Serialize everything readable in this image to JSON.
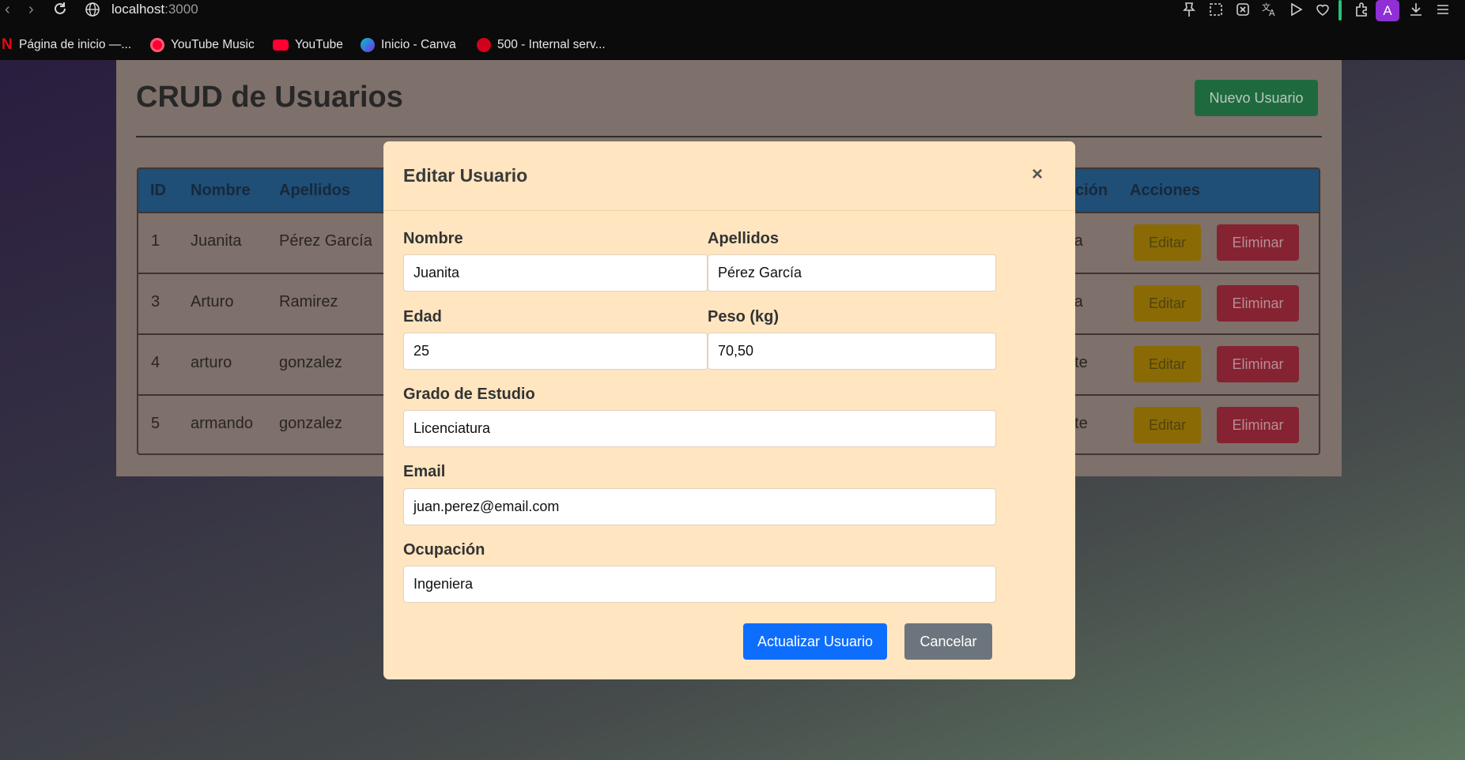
{
  "browser": {
    "url_host": "localhost",
    "url_port": ":3000",
    "avatar_letter": "A",
    "bookmarks": [
      {
        "label": "Página de inicio —...",
        "icon": "netflix-icon",
        "color": "#e50914"
      },
      {
        "label": "YouTube Music",
        "icon": "youtube-music-icon",
        "color": "#ff0033"
      },
      {
        "label": "YouTube",
        "icon": "youtube-icon",
        "color": "#ff0033"
      },
      {
        "label": "Inicio - Canva",
        "icon": "canva-icon",
        "color": "#00c4cc"
      },
      {
        "label": "500 - Internal serv...",
        "icon": "error-site-icon",
        "color": "#d0021b"
      }
    ]
  },
  "page": {
    "title": "CRUD de Usuarios",
    "new_user_label": "Nuevo Usuario",
    "table": {
      "headers": [
        "ID",
        "Nombre",
        "Apellidos",
        "ción",
        "Acciones"
      ],
      "rows": [
        {
          "id": "1",
          "nombre": "Juanita",
          "apellidos": "Pérez García",
          "tail": "ra"
        },
        {
          "id": "3",
          "nombre": "Arturo",
          "apellidos": "Ramirez",
          "tail": "ra"
        },
        {
          "id": "4",
          "nombre": "arturo",
          "apellidos": "gonzalez",
          "tail": "nte"
        },
        {
          "id": "5",
          "nombre": "armando",
          "apellidos": "gonzalez",
          "tail": "nte"
        }
      ],
      "edit_label": "Editar",
      "delete_label": "Eliminar"
    }
  },
  "modal": {
    "title": "Editar Usuario",
    "close_symbol": "×",
    "fields": {
      "nombre": {
        "label": "Nombre",
        "value": "Juanita"
      },
      "apellidos": {
        "label": "Apellidos",
        "value": "Pérez García"
      },
      "edad": {
        "label": "Edad",
        "value": "25"
      },
      "peso": {
        "label": "Peso (kg)",
        "value": "70,50"
      },
      "grado": {
        "label": "Grado de Estudio",
        "value": "Licenciatura"
      },
      "email": {
        "label": "Email",
        "value": "juan.perez@email.com"
      },
      "ocupacion": {
        "label": "Ocupación",
        "value": "Ingeniera"
      }
    },
    "submit_label": "Actualizar Usuario",
    "cancel_label": "Cancelar"
  },
  "colors": {
    "primary": "#0d6efd",
    "secondary": "#6c757d",
    "success": "#1e6a3e",
    "warning": "#8a6a05",
    "danger": "#852332",
    "modal_bg": "#ffe5c0"
  }
}
